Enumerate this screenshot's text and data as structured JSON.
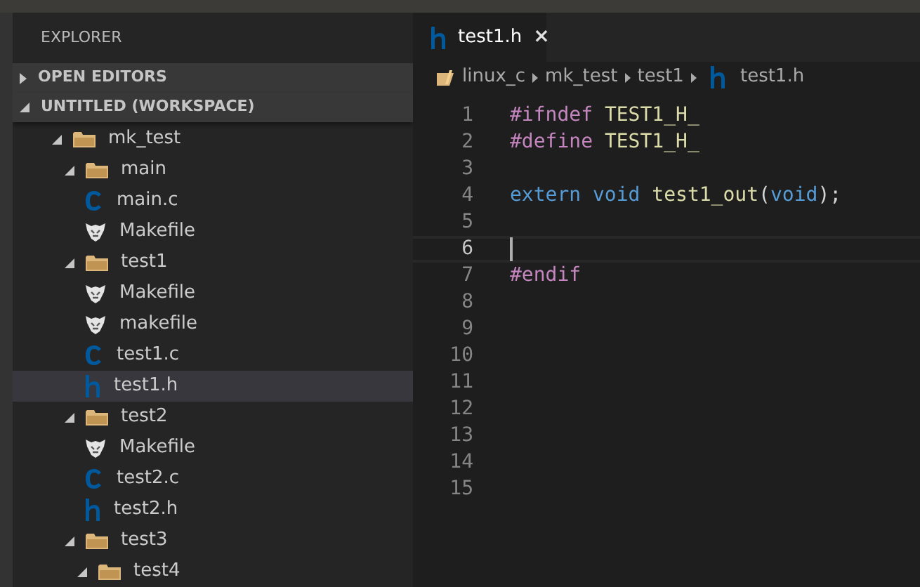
{
  "sidebar": {
    "title": "EXPLORER",
    "sections": [
      {
        "label": "OPEN EDITORS",
        "expanded": false
      },
      {
        "label": "UNTITLED (WORKSPACE)",
        "expanded": true
      }
    ],
    "tree": [
      {
        "label": "mk_test",
        "kind": "folder",
        "expanded": true,
        "selected": false,
        "children": [
          {
            "label": "main",
            "kind": "folder",
            "expanded": true,
            "selected": false,
            "children": [
              {
                "label": "main.c",
                "kind": "c",
                "selected": false
              },
              {
                "label": "Makefile",
                "kind": "makefile",
                "selected": false
              }
            ]
          },
          {
            "label": "test1",
            "kind": "folder",
            "expanded": true,
            "selected": false,
            "children": [
              {
                "label": "Makefile",
                "kind": "makefile",
                "selected": false
              },
              {
                "label": "makefile",
                "kind": "makefile",
                "selected": false
              },
              {
                "label": "test1.c",
                "kind": "c",
                "selected": false
              },
              {
                "label": "test1.h",
                "kind": "h",
                "selected": true
              }
            ]
          },
          {
            "label": "test2",
            "kind": "folder",
            "expanded": true,
            "selected": false,
            "children": [
              {
                "label": "Makefile",
                "kind": "makefile",
                "selected": false
              },
              {
                "label": "test2.c",
                "kind": "c",
                "selected": false
              },
              {
                "label": "test2.h",
                "kind": "h",
                "selected": false
              }
            ]
          },
          {
            "label": "test3",
            "kind": "folder",
            "expanded": true,
            "selected": false,
            "children": [
              {
                "label": "test4",
                "kind": "folder",
                "expanded": true,
                "selected": false
              }
            ]
          }
        ]
      }
    ]
  },
  "tabs": [
    {
      "label": "test1.h",
      "kind": "h",
      "selected": true,
      "close": "×"
    }
  ],
  "breadcrumbs": [
    {
      "label": "linux_c",
      "kind": "folder"
    },
    {
      "label": "mk_test",
      "kind": "plain"
    },
    {
      "label": "test1",
      "kind": "plain"
    },
    {
      "label": "test1.h",
      "kind": "h"
    }
  ],
  "editor": {
    "lines": [
      {
        "number": "1",
        "current": false,
        "tokens": [
          {
            "text": "#ifndef",
            "kind": "directive"
          },
          {
            "text": " TEST1_H_",
            "kind": "macro"
          }
        ]
      },
      {
        "number": "2",
        "current": false,
        "tokens": [
          {
            "text": "#define",
            "kind": "directive"
          },
          {
            "text": " TEST1_H_",
            "kind": "macro"
          }
        ]
      },
      {
        "number": "3",
        "current": false
      },
      {
        "number": "4",
        "current": false,
        "tokens": [
          {
            "text": "extern",
            "kind": "keyword"
          },
          {
            "text": " void",
            "kind": "keyword"
          },
          {
            "text": " test1_out",
            "kind": "function"
          },
          {
            "text": "(",
            "kind": "punct"
          },
          {
            "text": "void",
            "kind": "keyword"
          },
          {
            "text": ");",
            "kind": "punct"
          }
        ]
      },
      {
        "number": "5",
        "current": false
      },
      {
        "number": "6",
        "current": true
      },
      {
        "number": "7",
        "current": false,
        "tokens": [
          {
            "text": "#endif",
            "kind": "directive"
          }
        ]
      },
      {
        "number": "8",
        "current": false
      },
      {
        "number": "9",
        "current": false
      },
      {
        "number": "10",
        "current": false
      },
      {
        "number": "11",
        "current": false
      },
      {
        "number": "12",
        "current": false
      },
      {
        "number": "13",
        "current": false
      },
      {
        "number": "14",
        "current": false
      },
      {
        "number": "15",
        "current": false
      }
    ]
  }
}
